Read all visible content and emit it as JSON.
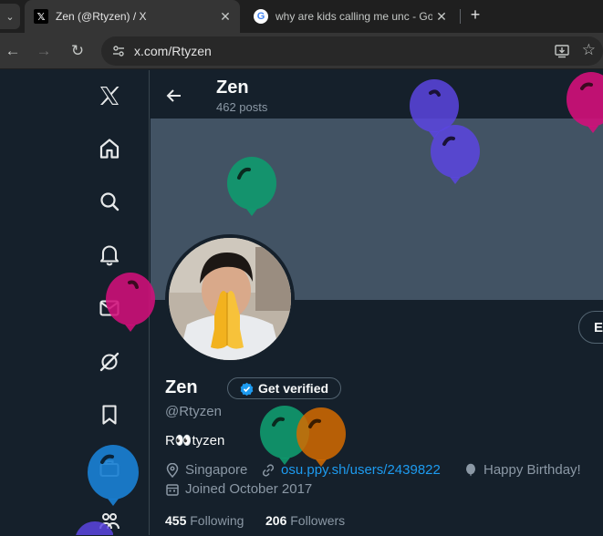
{
  "browser": {
    "tabs": [
      {
        "title": "Zen (@Rtyzen) / X",
        "favicon": "x-logo-icon",
        "active": true
      },
      {
        "title": "why are kids calling me unc - Go",
        "favicon": "google-g-icon",
        "active": false
      }
    ],
    "new_tab": "+",
    "url": "x.com/Rtyzen"
  },
  "header": {
    "name": "Zen",
    "posts_count": "462 posts"
  },
  "profile": {
    "display_name": "Zen",
    "get_verified": "Get verified",
    "handle": "@Rtyzen",
    "bio": "R👀tyzen",
    "location": "Singapore",
    "link": "osu.ppy.sh/users/2439822",
    "birthday": "Happy Birthday!",
    "joined": "Joined October 2017",
    "following_count": "455",
    "following_label": "Following",
    "followers_count": "206",
    "followers_label": "Followers",
    "edit_button": "Ed"
  },
  "colors": {
    "background": "#15202b",
    "banner": "#425364",
    "accent": "#1d9bf0",
    "balloon_purple": "#5b45e0",
    "balloon_green": "#0f9a6e",
    "balloon_pink": "#d10f7a",
    "balloon_orange": "#d36b00",
    "balloon_blue": "#1a7fd1"
  }
}
